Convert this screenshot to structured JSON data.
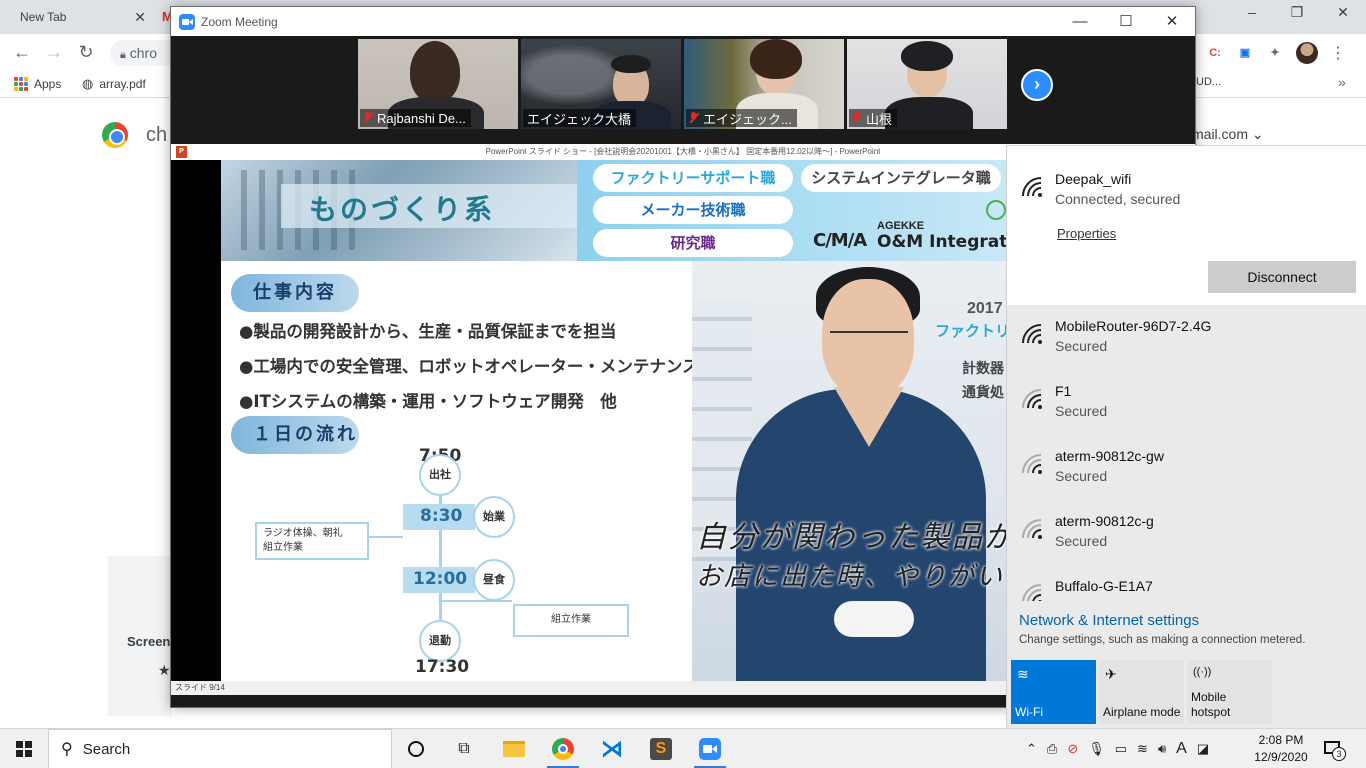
{
  "chrome": {
    "tab_title": "New Tab",
    "tab_close": "✕",
    "tab2_glyph": "M",
    "omnibox_text": "chro",
    "bookmarks": [
      {
        "label": "Apps",
        "icon": "apps-grid-icon"
      },
      {
        "label": "array.pdf",
        "icon": "globe-icon"
      }
    ],
    "content_title": "ch",
    "card_label": "Screen",
    "card_star": "★",
    "account_text": "mail.com",
    "bookmark_overflow": "UD...",
    "window_controls": [
      "–",
      "❐",
      "✕"
    ],
    "extension_letters": [
      "C:",
      "▣",
      "✦"
    ]
  },
  "zoom": {
    "window_title": "Zoom Meeting",
    "window_buttons": [
      "—",
      "☐",
      "✕"
    ],
    "participants": [
      {
        "name": "Rajbanshi De...",
        "muted": true
      },
      {
        "name": "エイジェック大橋",
        "muted": false
      },
      {
        "name": "エイジェック...",
        "muted": true
      },
      {
        "name": "山根",
        "muted": true
      }
    ],
    "next_arrow": "›"
  },
  "powerpoint": {
    "title": "PowerPoint スライド ショー - [会社説明会20201001【大橋・小黒さん】 固定本番用12.02以降〜] - PowerPoint",
    "icon_letter": "P",
    "status": "スライド 9/14"
  },
  "slide": {
    "header_title": "ものづくり系",
    "job_pills": [
      "ファクトリーサポート職",
      "メーカー技術職",
      "研究職",
      "システムインテグレータ職"
    ],
    "logo_mark": "C/M/A",
    "logo_brand": "AGEKKE",
    "logo_name": "O&M Integrate",
    "section_job": "仕事内容",
    "bullets": [
      "●製品の開発設計から、生産・品質保証までを担当",
      "●工場内での安全管理、ロボットオペレーター・メンテナンス",
      "●ITシステムの構築・運用・ソフトウェア開発　他"
    ],
    "section_flow": "１日の流れ",
    "flow": {
      "t1": "7:50",
      "c1": "出社",
      "t2": "8:30",
      "c2": "始業",
      "note1_line1": "ラジオ体操、朝礼",
      "note1_line2": "組立作業",
      "t3": "12:00",
      "c3": "昼食",
      "note2": "組立作業",
      "c4": "退勤",
      "t4": "17:30"
    },
    "photo_year": "2017",
    "photo_sub1": "ファクトリ",
    "photo_sub2": "計数器",
    "photo_sub3": "通貨処",
    "quote_line1": "自分が関わった製品が",
    "quote_line2": "お店に出た時、やりがいを"
  },
  "network": {
    "connected": {
      "name": "Deepak_wifi",
      "status": "Connected, secured"
    },
    "properties": "Properties",
    "disconnect": "Disconnect",
    "networks": [
      {
        "name": "MobileRouter-96D7-2.4G",
        "status": "Secured"
      },
      {
        "name": "F1",
        "status": "Secured"
      },
      {
        "name": "aterm-90812c-gw",
        "status": "Secured"
      },
      {
        "name": "aterm-90812c-g",
        "status": "Secured"
      },
      {
        "name": "Buffalo-G-E1A7",
        "status": ""
      }
    ],
    "settings_link": "Network & Internet settings",
    "settings_desc": "Change settings, such as making a connection metered.",
    "quick_actions": [
      {
        "label": "Wi-Fi",
        "active": true
      },
      {
        "label": "Airplane mode",
        "active": false
      },
      {
        "label_line1": "Mobile",
        "label_line2": "hotspot",
        "active": false
      }
    ],
    "quick_glyphs": {
      "wifi": "≋",
      "airplane": "✈",
      "hotspot": "((·))"
    }
  },
  "taskbar": {
    "search_placeholder": "Search",
    "time": "2:08 PM",
    "date": "12/9/2020",
    "notification_count": "3",
    "tray_language": "A",
    "tray_chevron": "⌃"
  },
  "colors": {
    "zoom_blue": "#2d8cff",
    "win_accent": "#0078d7",
    "active_speaker": "#7dd61e",
    "muted_red": "#e02828"
  }
}
